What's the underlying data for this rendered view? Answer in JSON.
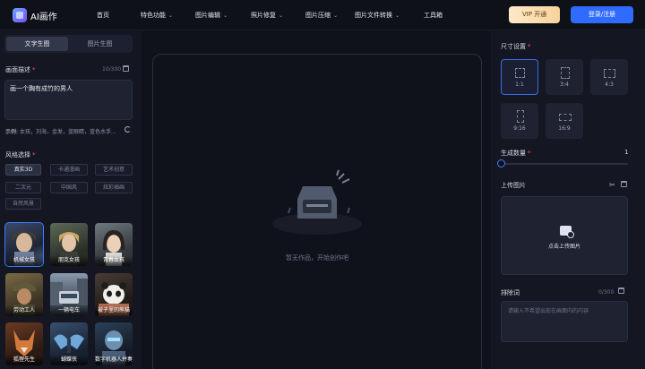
{
  "header": {
    "brand": "AI画作",
    "nav": [
      {
        "label": "首页",
        "has_menu": false
      },
      {
        "label": "特色功能",
        "has_menu": true
      },
      {
        "label": "图片编辑",
        "has_menu": true
      },
      {
        "label": "照片修复",
        "has_menu": true
      },
      {
        "label": "图片压缩",
        "has_menu": true
      },
      {
        "label": "图片文件转换",
        "has_menu": true
      },
      {
        "label": "工具箱",
        "has_menu": false
      }
    ],
    "vip_label": "VIP 开通",
    "login_label": "登录/注册"
  },
  "left": {
    "tabs": [
      "文字生图",
      "图片生图"
    ],
    "active_tab": 0,
    "prompt_label": "画面描述",
    "prompt_counter": "10/300",
    "prompt_value": "画一个胸有成竹的男人",
    "examples_label": "示例:",
    "examples_text": "女孩，刘海，金发，蓝眼睛，蓝色水手...",
    "style_label": "风格选择",
    "style_chips": [
      "真实3D",
      "卡通漫画",
      "艺术创意",
      "二次元",
      "中国风",
      "炫彩插画",
      "自然风景"
    ],
    "active_chip": 0,
    "style_cards": [
      {
        "label": "机械女孩",
        "selected": true
      },
      {
        "label": "朋克女孩",
        "selected": false
      },
      {
        "label": "青春女孩",
        "selected": false
      },
      {
        "label": "劳动工人",
        "selected": false
      },
      {
        "label": "一辆电车",
        "selected": false
      },
      {
        "label": "被子里的熊猫",
        "selected": false
      },
      {
        "label": "狐狸先生",
        "selected": false
      },
      {
        "label": "蝴蝶侠",
        "selected": false
      },
      {
        "label": "数字机器人并奏",
        "selected": false
      }
    ]
  },
  "center": {
    "empty_text": "暂无作品，开始创作吧"
  },
  "right": {
    "size_label": "尺寸设置",
    "ratios": [
      "1:1",
      "3:4",
      "4:3",
      "9:16",
      "16:9"
    ],
    "active_ratio": 0,
    "count_label": "生成数量",
    "count_value": "1",
    "count_fraction": 0.0,
    "upload_label": "上传图片",
    "upload_text": "点击上传图片",
    "negative_label": "排除词",
    "negative_counter": "0/300",
    "negative_placeholder": "请输入不希望出现在画面内的内容"
  },
  "colors": {
    "accent": "#3d7bff",
    "login_bg": "#2f6bff",
    "required": "#ff5a5a",
    "vip_gradient_start": "#fde9c8",
    "vip_gradient_end": "#f7d39a"
  }
}
